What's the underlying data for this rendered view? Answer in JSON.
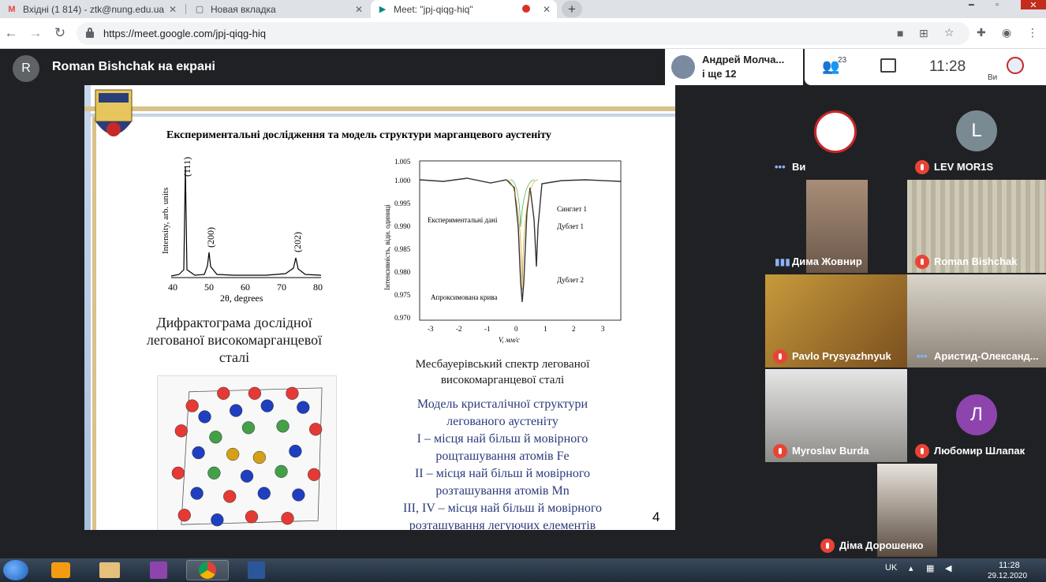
{
  "browser": {
    "tabs": [
      {
        "label": "Вхідні (1 814) - ztk@nung.edu.ua",
        "favicon": "gmail-icon"
      },
      {
        "label": "Новая вкладка",
        "favicon": "blank-page-icon"
      },
      {
        "label": "Meet: \"jpj-qiqg-hiq\"",
        "favicon": "meet-icon"
      }
    ],
    "new_tab_label": "+",
    "url": "https://meet.google.com/jpj-qiqg-hiq"
  },
  "meet": {
    "presenter_initial": "R",
    "presenter_label": "Roman Bishchak на екрані",
    "top_participant_name": "Андрей Молча...",
    "top_participant_more": "і ще 12",
    "participant_count": "23",
    "clock": "11:28",
    "self_label": "Ви"
  },
  "slide": {
    "title": "Експериментальні дослідження та модель структури марганцевого аустеніту",
    "diffractogram_caption": "Дифрактограма дослідної легованої високомарганцевої сталі",
    "mossbauer_caption": "Месбауерівський спектр легованої високомарганцевої сталі",
    "model_lines": [
      "Модель кристалічної структури",
      "легованого аустеніту",
      "I – місця най більш й мовірного",
      "рощташування атомів Fe",
      "II  – місця най більш й мовірного",
      "розташування атомів Mn",
      "III, IV – місця най більш й мовірного",
      "розташування легуючих елементів"
    ],
    "page_number": "4",
    "xrd": {
      "ylabel": "Intensity, arb. units",
      "xlabel": "2θ, degrees",
      "xticks": [
        "40",
        "50",
        "60",
        "70",
        "80"
      ],
      "peaks": [
        "(111)",
        "(200)",
        "(202)"
      ]
    },
    "moss": {
      "ylabel": "Інтенсивність, відн. одиниці",
      "xlabel": "V, мм/с",
      "yticks": [
        "1.005",
        "1.000",
        "0.995",
        "0.990",
        "0.985",
        "0.980",
        "0.975",
        "0.970"
      ],
      "xticks": [
        "-3",
        "-2",
        "-1",
        "0",
        "1",
        "2",
        "3"
      ],
      "labels": [
        "Експериментальні дані",
        "Синглет 1",
        "Дублет 1",
        "Дублет 2",
        "Апроксимована крива"
      ]
    }
  },
  "participants": [
    {
      "name": "Ви",
      "kind": "self"
    },
    {
      "name": "LEV MOR1S",
      "kind": "letter",
      "letter": "L",
      "color": "#7a8a93",
      "muted": true
    },
    {
      "name": "Дима Жовнир",
      "kind": "video",
      "muted": false
    },
    {
      "name": "Roman Bishchak",
      "kind": "video",
      "muted": true
    },
    {
      "name": "Pavlo Prysyazhnyuk",
      "kind": "video",
      "muted": true
    },
    {
      "name": "Аристид-Олександ...",
      "kind": "video",
      "muted": false
    },
    {
      "name": "Myroslav Burda",
      "kind": "video",
      "muted": true
    },
    {
      "name": "Любомир Шлапак",
      "kind": "letter",
      "letter": "Л",
      "color": "#8e44ad",
      "muted": true
    },
    {
      "name": "Діма Дорошенко",
      "kind": "video",
      "muted": true
    }
  ],
  "taskbar": {
    "lang": "UK",
    "time": "11:28",
    "date": "29.12.2020"
  }
}
